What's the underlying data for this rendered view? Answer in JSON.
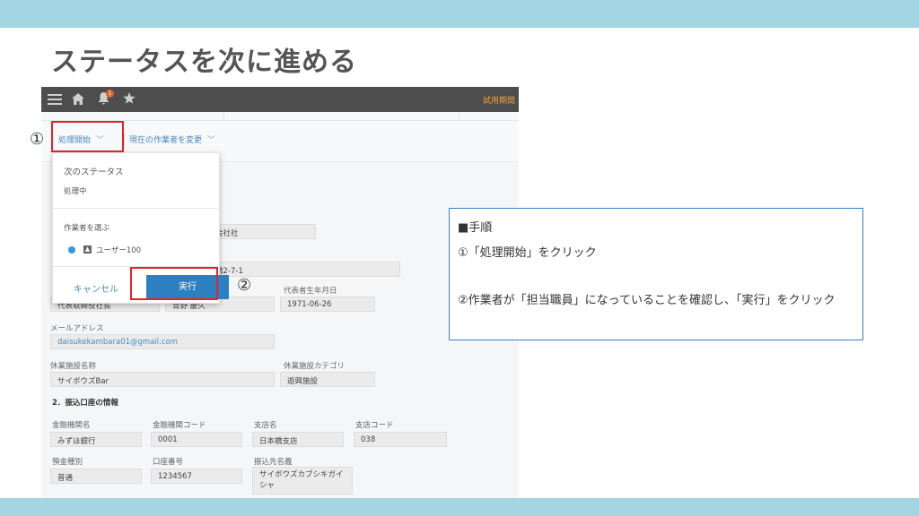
{
  "slide": {
    "title": "ステータスを次に進める"
  },
  "app": {
    "bell_badge": "1",
    "trial_label": "試用期間",
    "actions": {
      "process_start": "処理開始",
      "change_assignee": "現在の作業者を変更"
    }
  },
  "dropdown": {
    "next_status_title": "次のステータス",
    "next_status_value": "処理中",
    "assignee_title": "作業者を選ぶ",
    "assignee_option": "ユーザー100",
    "cancel_label": "キャンセル",
    "run_label": "実行"
  },
  "form": {
    "company_suffix": "会社社",
    "address_tail": "橋2-7-1",
    "position_value": "代表取締役社長",
    "rep_name_value": "青野 慶久",
    "birth_label": "代表者生年月日",
    "birth_value": "1971-06-26",
    "email_label": "メールアドレス",
    "email_value": "daisukekambara01@gmail.com",
    "facility_name_label": "休業施設名称",
    "facility_name_value": "サイボウズBar",
    "facility_cat_label": "休業施設カテゴリ",
    "facility_cat_value": "遊興施設",
    "section2_title": "2．振込口座の情報",
    "bank_label": "金融機関名",
    "bank_value": "みずほ銀行",
    "bank_code_label": "金融機関コード",
    "bank_code_value": "0001",
    "branch_label": "支店名",
    "branch_value": "日本橋支店",
    "branch_code_label": "支店コード",
    "branch_code_value": "038",
    "deposit_type_label": "預金種別",
    "deposit_type_value": "普通",
    "account_no_label": "口座番号",
    "account_no_value": "1234567",
    "payee_label": "振込先名義",
    "payee_value": "サイボウズカブシキガイシャ"
  },
  "markers": {
    "m1": "①",
    "m2": "②"
  },
  "instructions": {
    "heading": "■手順",
    "step1": "①「処理開始」をクリック",
    "step2": "②作業者が「担当職員」になっていることを確認し、「実行」をクリック"
  },
  "colors": {
    "band": "#a3d5e3",
    "highlight": "#e0242a",
    "primary_button": "#2c7fc1",
    "note_border": "#3a7fc0"
  }
}
